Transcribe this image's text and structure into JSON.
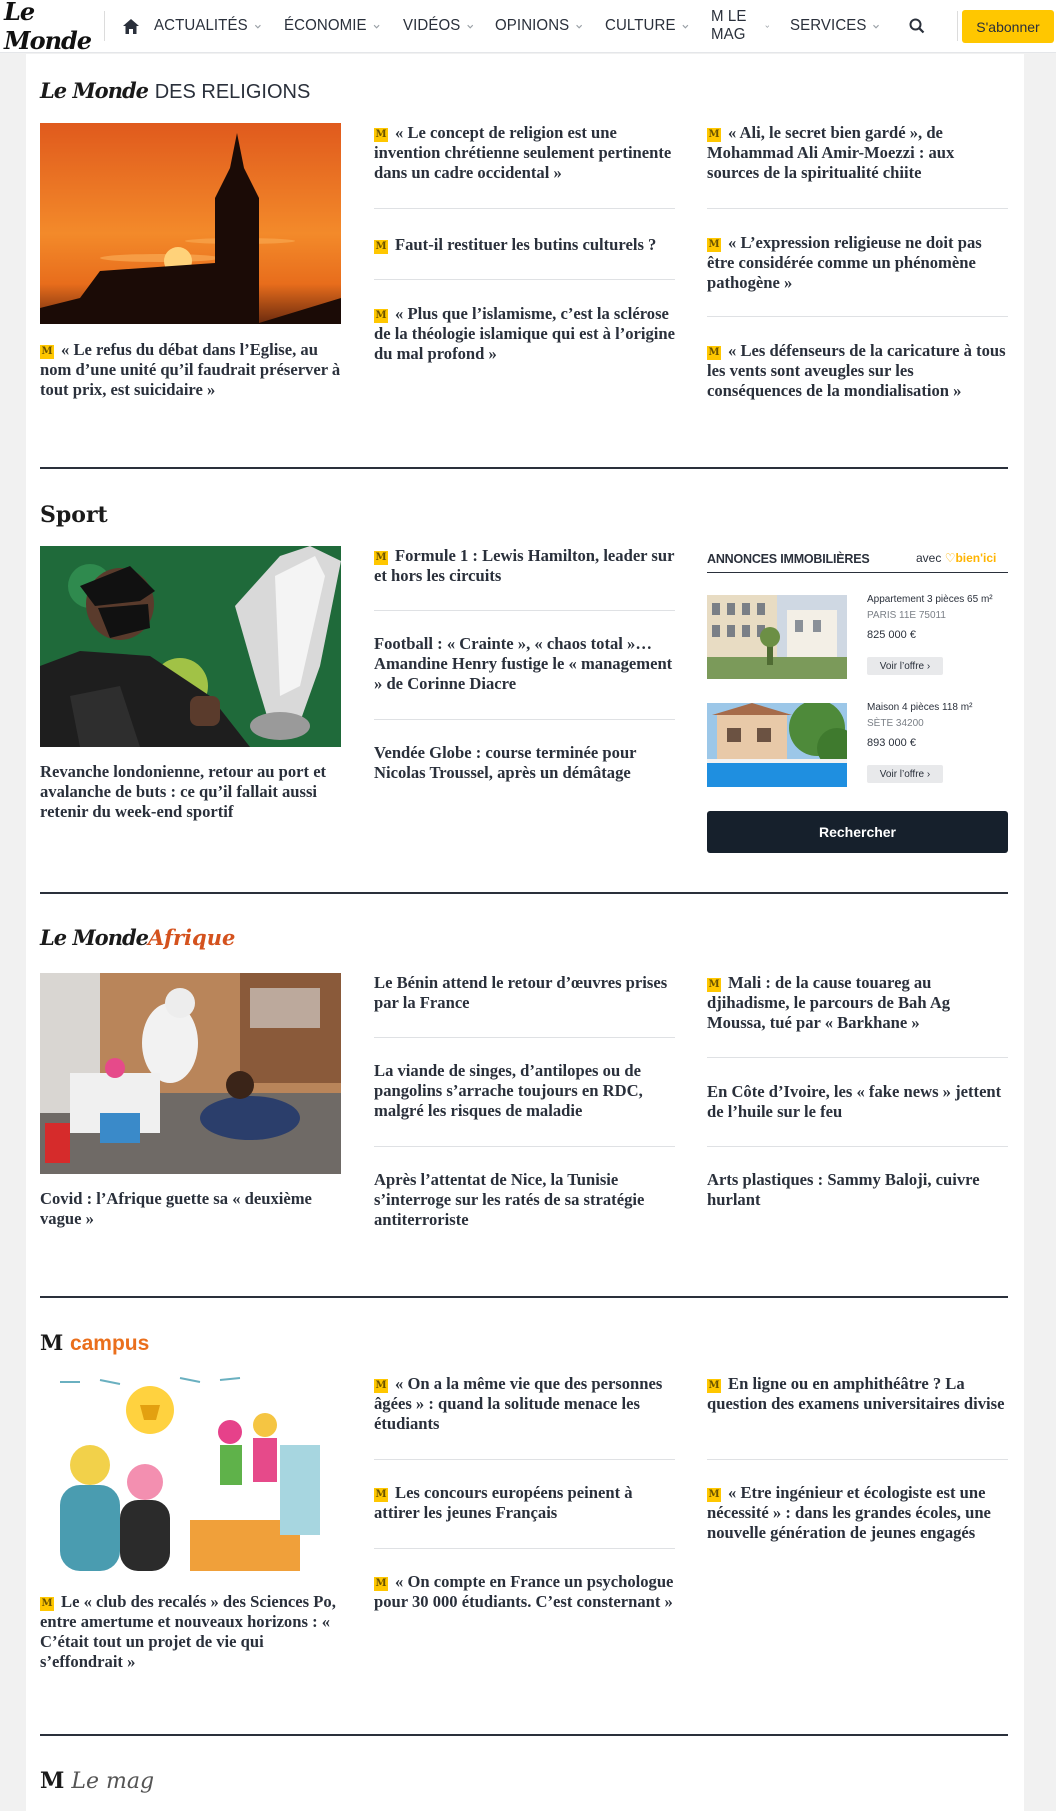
{
  "header": {
    "logo": "Le Monde",
    "nav": [
      "ACTUALITÉS",
      "ÉCONOMIE",
      "VIDÉOS",
      "OPINIONS",
      "CULTURE",
      "M LE MAG",
      "SERVICES"
    ],
    "subscribe": "S'abonner"
  },
  "religions": {
    "title_brand": "Le Monde",
    "title_rest": "DES RELIGIONS",
    "lead": "« Le refus du débat dans l’Eglise, au nom d’une unité qu’il faudrait préserver à tout prix, est suicidaire »",
    "col2": [
      "« Le concept de religion est une invention chrétienne seulement pertinente dans un cadre occidental »",
      "Faut-il restituer les butins culturels ?",
      "« Plus que l’islamisme, c’est la sclérose de la théologie islamique qui est à l’origine du mal profond »"
    ],
    "col3": [
      "« Ali, le secret bien gardé », de Mohammad Ali Amir-Moezzi : aux sources de la spiritualité chiite",
      "« L’expression religieuse ne doit pas être considérée comme un phénomène pathogène »",
      "« Les défenseurs de la caricature à tous les vents sont aveugles sur les conséquences de la mondialisation »"
    ]
  },
  "sport": {
    "title": "Sport",
    "lead": "Revanche londonienne, retour au port et avalanche de buts : ce qu’il fallait aussi retenir du week-end sportif",
    "col2": [
      "Formule 1 : Lewis Hamilton, leader sur et hors les circuits",
      "Football : « Crainte », « chaos total »… Amandine Henry fustige le « management » de Corinne Diacre",
      "Vendée Globe : course terminée pour Nicolas Troussel, après un démâtage"
    ]
  },
  "annonces": {
    "title": "ANNONCES IMMOBILIÈRES",
    "partner_prefix": "avec",
    "partner_name": "bien'ici",
    "items": [
      {
        "type": "Appartement 3 pièces 65 m²",
        "city": "PARIS 11E 75011",
        "price": "825 000 €",
        "cta": "Voir l’offre ›"
      },
      {
        "type": "Maison 4 pièces 118 m²",
        "city": "SÈTE 34200",
        "price": "893 000 €",
        "cta": "Voir l’offre ›"
      }
    ],
    "search": "Rechercher"
  },
  "afrique": {
    "title_brand": "Le Monde",
    "title_rest": "Afrique",
    "lead": "Covid : l’Afrique guette sa « deuxième vague »",
    "col2": [
      "Le Bénin attend le retour d’œuvres prises par la France",
      "La viande de singes, d’antilopes ou de pangolins s’arrache toujours en RDC, malgré les risques de maladie",
      "Après l’attentat de Nice, la Tunisie s’interroge sur les ratés de sa stratégie antiterroriste"
    ],
    "col3": [
      "Mali : de la cause touareg au djihadisme, le parcours de Bah Ag Moussa, tué par « Barkhane »",
      "En Côte d’Ivoire, les « fake news » jettent de l’huile sur le feu",
      "Arts plastiques : Sammy Baloji, cuivre hurlant"
    ]
  },
  "campus": {
    "title_m": "M",
    "title_rest": "campus",
    "lead": "Le « club des recalés » des Sciences Po, entre amertume et nouveaux horizons : « C’était tout un projet de vie qui s’effondrait »",
    "col2": [
      "« On a la même vie que des personnes âgées » : quand la solitude menace les étudiants",
      "Les concours européens peinent à attirer les jeunes Français",
      "« On compte en France un psychologue pour 30 000 étudiants. C’est consternant »"
    ],
    "col3": [
      "En ligne ou en amphithéâtre ? La question des examens universitaires divise",
      "« Etre ingénieur et écologiste est une nécessité » : dans les grandes écoles, une nouvelle génération de jeunes engagés"
    ]
  },
  "mag": {
    "title_m": "M",
    "title_rest": "Le mag"
  },
  "badge_letter": "M"
}
